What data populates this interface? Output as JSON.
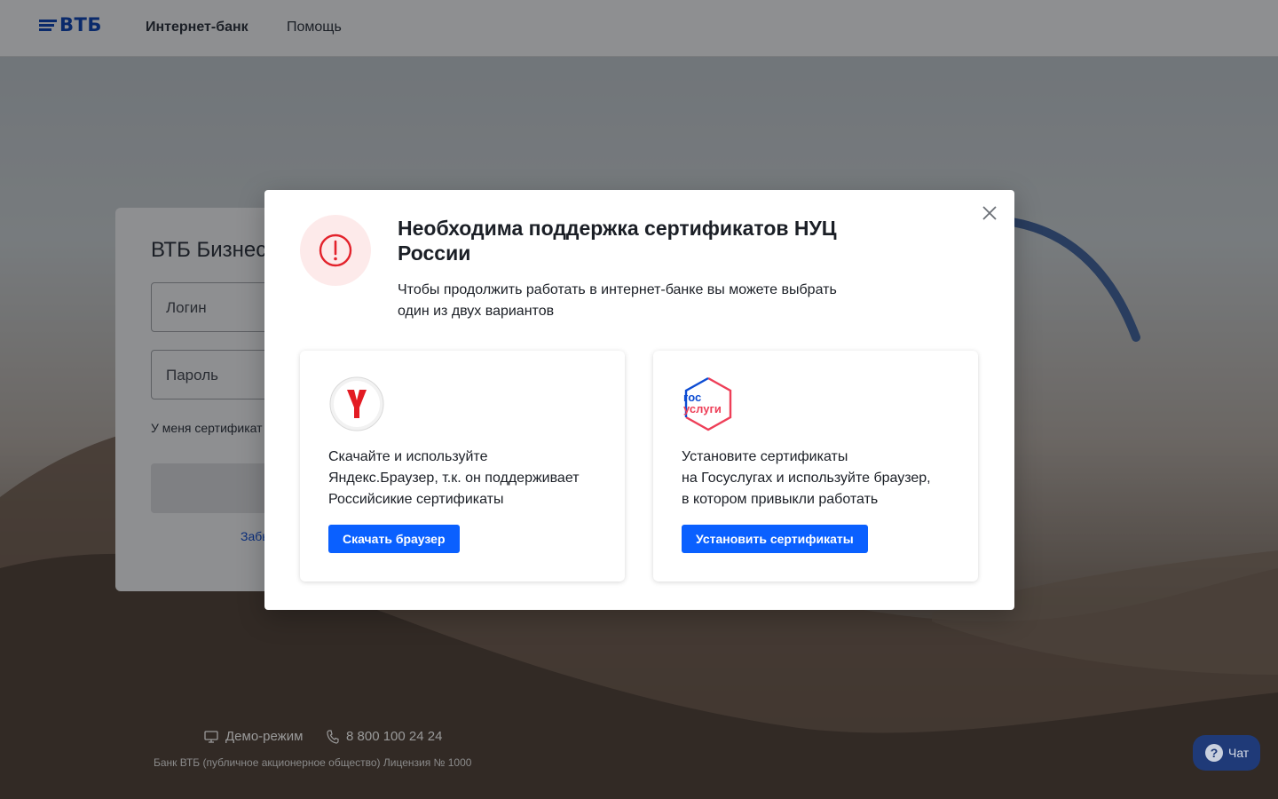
{
  "header": {
    "logo_text": "ВТБ",
    "nav": {
      "internet_bank": "Интернет-банк",
      "help": "Помощь"
    }
  },
  "login": {
    "title": "ВТБ Бизнес",
    "login_placeholder": "Логин",
    "password_placeholder": "Пароль",
    "cert_text": "У меня сертификат",
    "forgot_text": "Забыли"
  },
  "modal": {
    "title": "Необходима поддержка сертификатов НУЦ России",
    "subtitle": "Чтобы продолжить работать в интернет-банке вы можете выбрать один из двух вариантов",
    "options": [
      {
        "icon": "yandex-browser-icon",
        "text": "Скачайте и используйте\nЯндекс.Браузер, т.к. он поддерживает\nРоссийсикие сертификаты",
        "button": "Скачать браузер"
      },
      {
        "icon": "gosuslugi-icon",
        "logo_line1": "гос",
        "logo_line2": "услуги",
        "text": "Установите сертификаты\nна Госуслугах и используйте браузер,\nв котором привыкли работать",
        "button": "Установить сертификаты"
      }
    ]
  },
  "footer": {
    "demo": "Демо-режим",
    "phone": "8 800 100 24 24",
    "legal": "Банк ВТБ (публичное акционерное общество) Лицензия № 1000"
  },
  "chat": {
    "label": "Чат",
    "icon_glyph": "?"
  },
  "colors": {
    "accent": "#0a60ff",
    "brand": "#0a2a6b",
    "alert": "#e3232c"
  }
}
